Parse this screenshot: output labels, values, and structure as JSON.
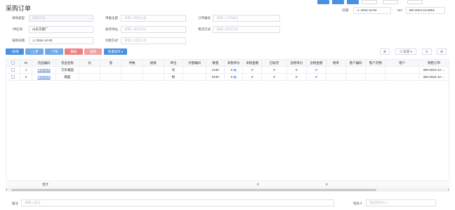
{
  "page": {
    "title": "采购订单"
  },
  "top_buttons": [
    "",
    "",
    "",
    "",
    "",
    ""
  ],
  "date": {
    "label": "日期:",
    "value": "2024-12-02"
  },
  "no": {
    "label": "NO:",
    "value": "BO-2024-12-0001"
  },
  "form": {
    "purchase_type": {
      "label": "采购类型",
      "placeholder": "采购计划"
    },
    "order_subject": {
      "label": "单据主题",
      "placeholder": "请输入单据主题"
    },
    "order_no": {
      "label": "订单编号",
      "placeholder": "请输入订单编号"
    },
    "supplier": {
      "label": "供应商",
      "required_mark": "*",
      "value": "山东京题厂"
    },
    "receive_addr": {
      "label": "收货地址",
      "placeholder": "请输入收货地址"
    },
    "logistics": {
      "label": "物流方式",
      "placeholder": "请输入物流方式"
    },
    "purchase_date": {
      "label": "采购日期",
      "value": "2024-12-02"
    },
    "pay_method": {
      "label": "付款方式",
      "placeholder": "请输入付款方式"
    }
  },
  "toolbar": {
    "add": "+新增",
    "up": "↑上移",
    "down": "↓下移",
    "delete": "删除",
    "copy": "复制",
    "batch": "批量操作 ▾",
    "settings_icon": "gear",
    "label_filter": "标签",
    "refresh_icon": "refresh"
  },
  "table": {
    "headers": [
      "ID",
      "货品编码",
      "货品名称",
      "长",
      "宽",
      "件数",
      "规格",
      "单位",
      "外部编码",
      "数量",
      "未税单价",
      "未税金额",
      "已收货",
      "含税单价",
      "含税金额",
      "税率",
      "客户编码",
      "客户货物",
      "客户",
      "销售订单"
    ],
    "rows": [
      [
        "1",
        "YS00002",
        "方形箱面",
        "",
        "",
        "",
        "",
        "块",
        "",
        "2100",
        "0",
        "0",
        "0",
        "0",
        "0",
        "",
        "",
        "",
        "",
        "BM-2024-12-..."
      ],
      [
        "2",
        "YS00003",
        "箱面",
        "",
        "",
        "",
        "",
        "根",
        "",
        "8100",
        "0",
        "0",
        "0",
        "0",
        "0",
        "",
        "",
        "",
        "",
        "BM-2024-12-..."
      ]
    ],
    "total_label": "合计",
    "total_untaxed": "0",
    "total_taxed": "0"
  },
  "footer": {
    "remark": {
      "label": "备注",
      "placeholder": "请输入备注"
    },
    "handler": {
      "label": "经办人",
      "placeholder": "请选择经办人"
    }
  },
  "colors": {
    "primary": "#4a90e2",
    "danger": "#f08080",
    "link": "#1a56c9"
  }
}
